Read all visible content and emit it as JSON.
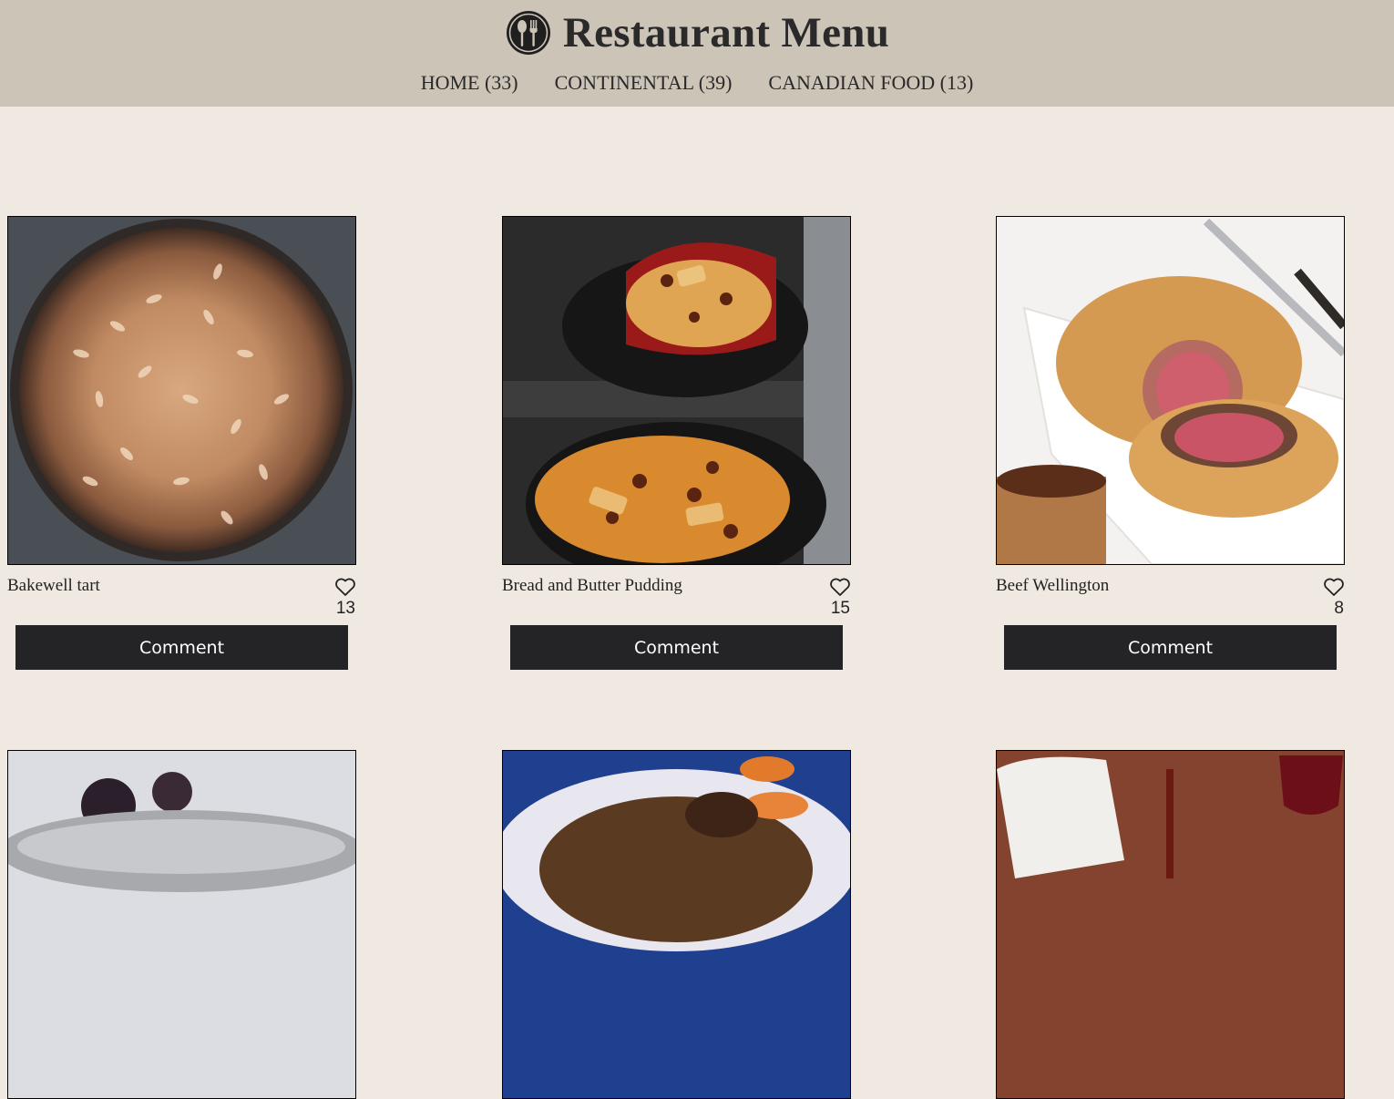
{
  "header": {
    "title": "Restaurant Menu",
    "logo_icon": "spoon-fork-icon",
    "nav": [
      {
        "label": "HOME (33)"
      },
      {
        "label": "CONTINENTAL (39)"
      },
      {
        "label": "CANADIAN FOOD (13)"
      }
    ]
  },
  "colors": {
    "header_bg": "#cdc4b8",
    "page_bg": "#f0e9e2",
    "button_bg": "#242427",
    "button_text": "#ffffff"
  },
  "items": [
    {
      "name": "Bakewell tart",
      "likes": "13",
      "comment_label": "Comment",
      "like_icon": "heart-outline-icon"
    },
    {
      "name": "Bread and Butter Pudding",
      "likes": "15",
      "comment_label": "Comment",
      "like_icon": "heart-outline-icon"
    },
    {
      "name": "Beef Wellington",
      "likes": "8",
      "comment_label": "Comment",
      "like_icon": "heart-outline-icon"
    }
  ]
}
